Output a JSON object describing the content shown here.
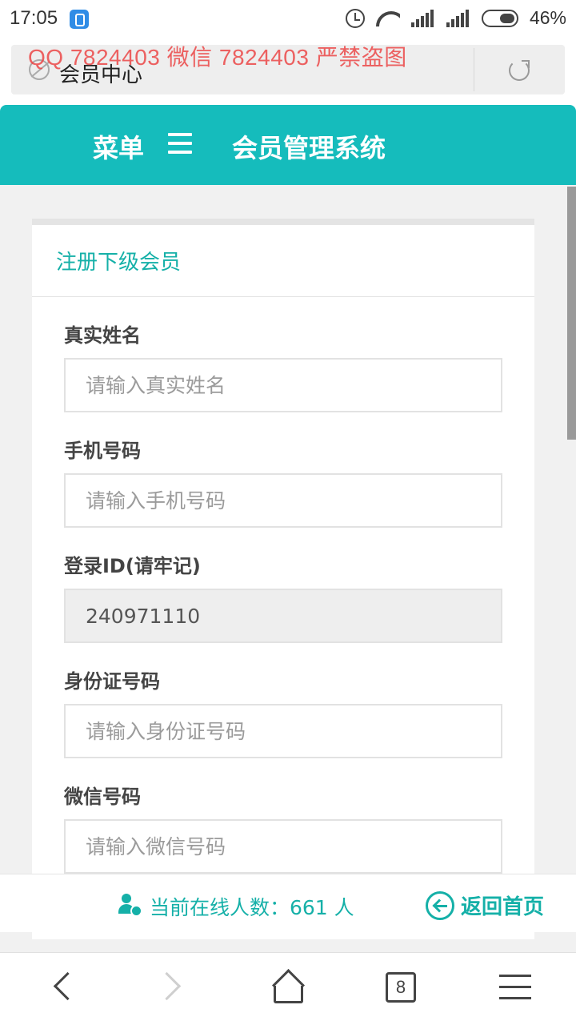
{
  "status_bar": {
    "time": "17:05",
    "battery": "46%",
    "icons": [
      "app-notification-icon",
      "alarm-icon",
      "wifi-icon",
      "signal-icon",
      "signal-icon",
      "battery-icon"
    ]
  },
  "browser": {
    "address_title": "会员中心",
    "watermark": "QQ 7824403  微信 7824403 严禁盗图",
    "tab_count": "8"
  },
  "header": {
    "menu_label": "菜单",
    "system_title": "会员管理系统"
  },
  "form": {
    "title": "注册下级会员",
    "fields": [
      {
        "label": "真实姓名",
        "placeholder": "请输入真实姓名",
        "value": ""
      },
      {
        "label": "手机号码",
        "placeholder": "请输入手机号码",
        "value": ""
      },
      {
        "label": "登录ID(请牢记)",
        "placeholder": "",
        "value": "240971110"
      },
      {
        "label": "身份证号码",
        "placeholder": "请输入身份证号码",
        "value": ""
      },
      {
        "label": "微信号码",
        "placeholder": "请输入微信号码",
        "value": ""
      }
    ]
  },
  "footer": {
    "online_text": "当前在线人数：661 人",
    "back_home": "返回首页"
  },
  "colors": {
    "accent": "#15bcbc",
    "accent_text": "#15b0a8",
    "watermark": "#eb4646"
  }
}
